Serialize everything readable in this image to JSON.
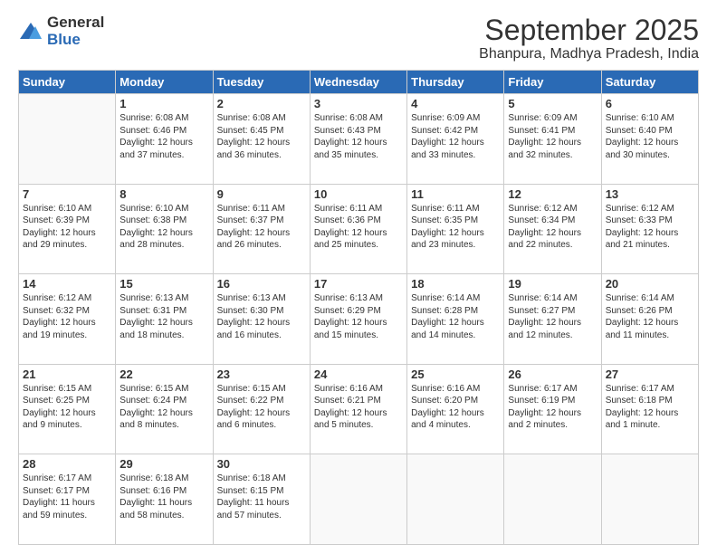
{
  "logo": {
    "general": "General",
    "blue": "Blue"
  },
  "title": "September 2025",
  "subtitle": "Bhanpura, Madhya Pradesh, India",
  "days": [
    "Sunday",
    "Monday",
    "Tuesday",
    "Wednesday",
    "Thursday",
    "Friday",
    "Saturday"
  ],
  "weeks": [
    [
      {
        "num": "",
        "info": ""
      },
      {
        "num": "1",
        "info": "Sunrise: 6:08 AM\nSunset: 6:46 PM\nDaylight: 12 hours\nand 37 minutes."
      },
      {
        "num": "2",
        "info": "Sunrise: 6:08 AM\nSunset: 6:45 PM\nDaylight: 12 hours\nand 36 minutes."
      },
      {
        "num": "3",
        "info": "Sunrise: 6:08 AM\nSunset: 6:43 PM\nDaylight: 12 hours\nand 35 minutes."
      },
      {
        "num": "4",
        "info": "Sunrise: 6:09 AM\nSunset: 6:42 PM\nDaylight: 12 hours\nand 33 minutes."
      },
      {
        "num": "5",
        "info": "Sunrise: 6:09 AM\nSunset: 6:41 PM\nDaylight: 12 hours\nand 32 minutes."
      },
      {
        "num": "6",
        "info": "Sunrise: 6:10 AM\nSunset: 6:40 PM\nDaylight: 12 hours\nand 30 minutes."
      }
    ],
    [
      {
        "num": "7",
        "info": "Sunrise: 6:10 AM\nSunset: 6:39 PM\nDaylight: 12 hours\nand 29 minutes."
      },
      {
        "num": "8",
        "info": "Sunrise: 6:10 AM\nSunset: 6:38 PM\nDaylight: 12 hours\nand 28 minutes."
      },
      {
        "num": "9",
        "info": "Sunrise: 6:11 AM\nSunset: 6:37 PM\nDaylight: 12 hours\nand 26 minutes."
      },
      {
        "num": "10",
        "info": "Sunrise: 6:11 AM\nSunset: 6:36 PM\nDaylight: 12 hours\nand 25 minutes."
      },
      {
        "num": "11",
        "info": "Sunrise: 6:11 AM\nSunset: 6:35 PM\nDaylight: 12 hours\nand 23 minutes."
      },
      {
        "num": "12",
        "info": "Sunrise: 6:12 AM\nSunset: 6:34 PM\nDaylight: 12 hours\nand 22 minutes."
      },
      {
        "num": "13",
        "info": "Sunrise: 6:12 AM\nSunset: 6:33 PM\nDaylight: 12 hours\nand 21 minutes."
      }
    ],
    [
      {
        "num": "14",
        "info": "Sunrise: 6:12 AM\nSunset: 6:32 PM\nDaylight: 12 hours\nand 19 minutes."
      },
      {
        "num": "15",
        "info": "Sunrise: 6:13 AM\nSunset: 6:31 PM\nDaylight: 12 hours\nand 18 minutes."
      },
      {
        "num": "16",
        "info": "Sunrise: 6:13 AM\nSunset: 6:30 PM\nDaylight: 12 hours\nand 16 minutes."
      },
      {
        "num": "17",
        "info": "Sunrise: 6:13 AM\nSunset: 6:29 PM\nDaylight: 12 hours\nand 15 minutes."
      },
      {
        "num": "18",
        "info": "Sunrise: 6:14 AM\nSunset: 6:28 PM\nDaylight: 12 hours\nand 14 minutes."
      },
      {
        "num": "19",
        "info": "Sunrise: 6:14 AM\nSunset: 6:27 PM\nDaylight: 12 hours\nand 12 minutes."
      },
      {
        "num": "20",
        "info": "Sunrise: 6:14 AM\nSunset: 6:26 PM\nDaylight: 12 hours\nand 11 minutes."
      }
    ],
    [
      {
        "num": "21",
        "info": "Sunrise: 6:15 AM\nSunset: 6:25 PM\nDaylight: 12 hours\nand 9 minutes."
      },
      {
        "num": "22",
        "info": "Sunrise: 6:15 AM\nSunset: 6:24 PM\nDaylight: 12 hours\nand 8 minutes."
      },
      {
        "num": "23",
        "info": "Sunrise: 6:15 AM\nSunset: 6:22 PM\nDaylight: 12 hours\nand 6 minutes."
      },
      {
        "num": "24",
        "info": "Sunrise: 6:16 AM\nSunset: 6:21 PM\nDaylight: 12 hours\nand 5 minutes."
      },
      {
        "num": "25",
        "info": "Sunrise: 6:16 AM\nSunset: 6:20 PM\nDaylight: 12 hours\nand 4 minutes."
      },
      {
        "num": "26",
        "info": "Sunrise: 6:17 AM\nSunset: 6:19 PM\nDaylight: 12 hours\nand 2 minutes."
      },
      {
        "num": "27",
        "info": "Sunrise: 6:17 AM\nSunset: 6:18 PM\nDaylight: 12 hours\nand 1 minute."
      }
    ],
    [
      {
        "num": "28",
        "info": "Sunrise: 6:17 AM\nSunset: 6:17 PM\nDaylight: 11 hours\nand 59 minutes."
      },
      {
        "num": "29",
        "info": "Sunrise: 6:18 AM\nSunset: 6:16 PM\nDaylight: 11 hours\nand 58 minutes."
      },
      {
        "num": "30",
        "info": "Sunrise: 6:18 AM\nSunset: 6:15 PM\nDaylight: 11 hours\nand 57 minutes."
      },
      {
        "num": "",
        "info": ""
      },
      {
        "num": "",
        "info": ""
      },
      {
        "num": "",
        "info": ""
      },
      {
        "num": "",
        "info": ""
      }
    ]
  ]
}
